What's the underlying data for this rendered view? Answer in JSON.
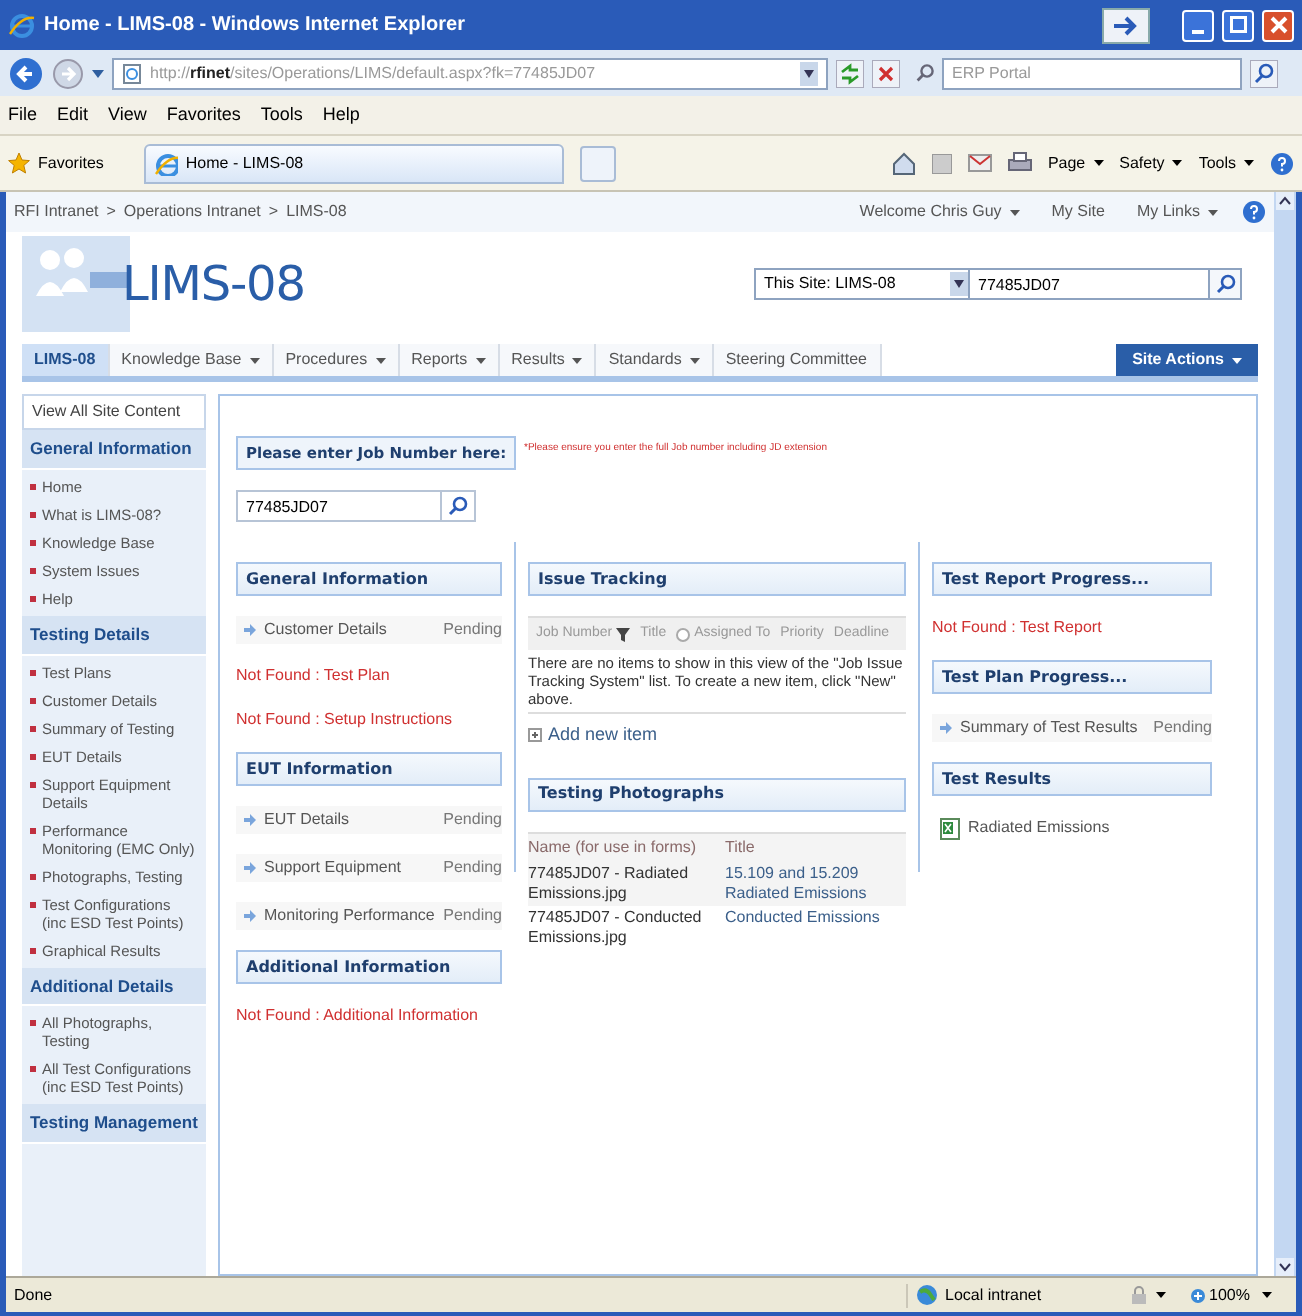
{
  "window": {
    "title": "Home - LIMS-08 - Windows Internet Explorer"
  },
  "address_bar": {
    "prefix": "http://",
    "host": "rfinet",
    "path": "/sites/Operations/LIMS/default.aspx?fk=77485JD07",
    "search_placeholder": "ERP Portal"
  },
  "menu": [
    "File",
    "Edit",
    "View",
    "Favorites",
    "Tools",
    "Help"
  ],
  "favorites_bar": {
    "favorites": "Favorites",
    "tab": "Home - LIMS-08",
    "commands": [
      "Page",
      "Safety",
      "Tools"
    ]
  },
  "site": {
    "breadcrumb_separator": ">",
    "breadcrumb": [
      "RFI Intranet",
      "Operations Intranet",
      "LIMS-08"
    ],
    "welcome": "Welcome Chris Guy",
    "links": [
      "My Site",
      "My Links"
    ],
    "logo": "LIMS-08",
    "scope": "This Site: LIMS-08",
    "search_value": "77485JD07"
  },
  "tabs": [
    {
      "label": "LIMS-08",
      "selected": true,
      "dropdown": false
    },
    {
      "label": "Knowledge Base",
      "selected": false,
      "dropdown": true
    },
    {
      "label": "Procedures",
      "selected": false,
      "dropdown": true
    },
    {
      "label": "Reports",
      "selected": false,
      "dropdown": true
    },
    {
      "label": "Results",
      "selected": false,
      "dropdown": true
    },
    {
      "label": "Standards",
      "selected": false,
      "dropdown": true
    },
    {
      "label": "Steering Committee",
      "selected": false,
      "dropdown": false
    }
  ],
  "site_actions": "Site Actions",
  "sidebar": {
    "view_all": "View All Site Content",
    "sections": [
      {
        "heading": "General Information",
        "items": [
          "Home",
          "What is LIMS-08?",
          "Knowledge Base",
          "System Issues",
          "Help"
        ]
      },
      {
        "heading": "Testing Details",
        "items": [
          "Test Plans",
          "Customer Details",
          "Summary of Testing",
          "EUT Details",
          "Support Equipment Details",
          "Performance Monitoring (EMC Only)",
          "Photographs, Testing",
          "Test Configurations (inc ESD Test Points)",
          "Graphical Results"
        ]
      },
      {
        "heading": "Additional Details",
        "items": [
          "All Photographs, Testing",
          "All Test Configurations (inc ESD Test Points)"
        ]
      },
      {
        "heading": "Testing Management"
      }
    ]
  },
  "job": {
    "label": "Please enter Job Number here:",
    "note": "*Please ensure you enter the full Job number including JD extension",
    "value": "77485JD07"
  },
  "columns": [
    {
      "parts": [
        {
          "kind": "links",
          "title": "General Information",
          "items": [
            {
              "kind": "status",
              "label": "Customer Details",
              "status": "Pending"
            },
            {
              "kind": "missing",
              "text": "Not Found : Test Plan"
            },
            {
              "kind": "missing",
              "text": "Not Found : Setup Instructions"
            }
          ]
        },
        {
          "kind": "links",
          "title": "EUT Information",
          "items": [
            {
              "kind": "status",
              "label": "EUT Details",
              "status": "Pending"
            },
            {
              "kind": "status",
              "label": "Support Equipment",
              "status": "Pending"
            },
            {
              "kind": "status",
              "label": "Monitoring Performance",
              "status": "Pending"
            }
          ]
        },
        {
          "kind": "links",
          "title": "Additional Information",
          "items": [
            {
              "kind": "missing",
              "text": "Not Found : Additional Information"
            }
          ]
        }
      ]
    },
    {
      "parts": [
        {
          "kind": "issues",
          "title": "Issue Tracking",
          "columns": [
            "Job Number",
            "Title",
            "Assigned To",
            "Priority",
            "Deadline"
          ],
          "empty_message": "There are no items to show in this view of the \"Job Issue Tracking System\" list. To create a new item, click \"New\" above.",
          "add_new": "Add new item"
        },
        {
          "kind": "photos",
          "title": "Testing Photographs",
          "columns": [
            "Name (for use in forms)",
            "Title"
          ],
          "rows": [
            [
              "77485JD07 - Radiated Emissions.jpg",
              "15.109 and 15.209 Radiated Emissions"
            ],
            [
              "77485JD07 - Conducted Emissions.jpg",
              "Conducted Emissions"
            ]
          ]
        }
      ]
    },
    {
      "parts": [
        {
          "kind": "links",
          "title": "Test Report Progress...",
          "items": [
            {
              "kind": "missing",
              "text": "Not Found : Test Report"
            }
          ]
        },
        {
          "kind": "links",
          "title": "Test Plan Progress...",
          "items": [
            {
              "kind": "status",
              "label": "Summary of Test Results",
              "status": "Pending"
            }
          ]
        },
        {
          "kind": "links",
          "title": "Test Results",
          "items": [
            {
              "kind": "document",
              "label": "Radiated Emissions"
            }
          ]
        }
      ]
    }
  ],
  "status_bar": {
    "status": "Done",
    "zone": "Local intranet",
    "zoom": "100%"
  }
}
